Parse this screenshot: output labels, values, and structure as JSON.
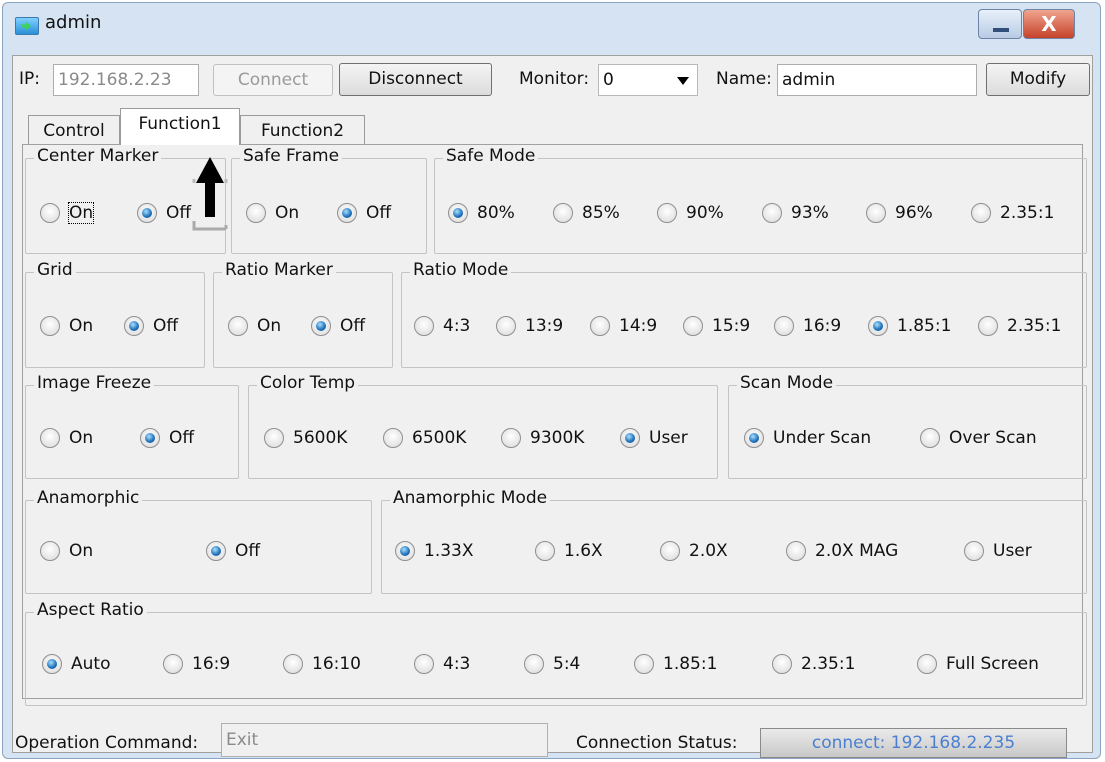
{
  "window": {
    "title": "admin",
    "close_glyph": "X"
  },
  "toolbar": {
    "ip_label": "IP:",
    "ip_value": "192.168.2.23",
    "connect_label": "Connect",
    "disconnect_label": "Disconnect",
    "monitor_label": "Monitor:",
    "monitor_value": "0",
    "name_label": "Name:",
    "name_value": "admin",
    "modify_label": "Modify"
  },
  "tabs": [
    {
      "label": "Control",
      "active": false
    },
    {
      "label": "Function1",
      "active": true
    },
    {
      "label": "Function2",
      "active": false
    }
  ],
  "groups": {
    "center_marker": {
      "title": "Center Marker",
      "options": [
        "On",
        "Off"
      ],
      "selected": "Off"
    },
    "safe_frame": {
      "title": "Safe Frame",
      "options": [
        "On",
        "Off"
      ],
      "selected": "Off"
    },
    "safe_mode": {
      "title": "Safe Mode",
      "options": [
        "80%",
        "85%",
        "90%",
        "93%",
        "96%",
        "2.35:1"
      ],
      "selected": "80%"
    },
    "grid": {
      "title": "Grid",
      "options": [
        "On",
        "Off"
      ],
      "selected": "Off"
    },
    "ratio_marker": {
      "title": "Ratio Marker",
      "options": [
        "On",
        "Off"
      ],
      "selected": "Off"
    },
    "ratio_mode": {
      "title": "Ratio Mode",
      "options": [
        "4:3",
        "13:9",
        "14:9",
        "15:9",
        "16:9",
        "1.85:1",
        "2.35:1"
      ],
      "selected": "1.85:1"
    },
    "image_freeze": {
      "title": "Image Freeze",
      "options": [
        "On",
        "Off"
      ],
      "selected": "Off"
    },
    "color_temp": {
      "title": "Color Temp",
      "options": [
        "5600K",
        "6500K",
        "9300K",
        "User"
      ],
      "selected": "User"
    },
    "scan_mode": {
      "title": "Scan Mode",
      "options": [
        "Under Scan",
        "Over Scan"
      ],
      "selected": "Under Scan"
    },
    "anamorphic": {
      "title": "Anamorphic",
      "options": [
        "On",
        "Off"
      ],
      "selected": "Off"
    },
    "anamorphic_mode": {
      "title": "Anamorphic Mode",
      "options": [
        "1.33X",
        "1.6X",
        "2.0X",
        "2.0X MAG",
        "User"
      ],
      "selected": "1.33X"
    },
    "aspect_ratio": {
      "title": "Aspect Ratio",
      "options": [
        "Auto",
        "16:9",
        "16:10",
        "4:3",
        "5:4",
        "1.85:1",
        "2.35:1",
        "Full Screen"
      ],
      "selected": "Auto"
    }
  },
  "footer": {
    "operation_label": "Operation Command:",
    "operation_value": "Exit",
    "status_label": "Connection Status:",
    "status_value": "connect: 192.168.2.235"
  },
  "colors": {
    "accent": "#1d6fb8",
    "status_text": "#4a7fd0"
  }
}
